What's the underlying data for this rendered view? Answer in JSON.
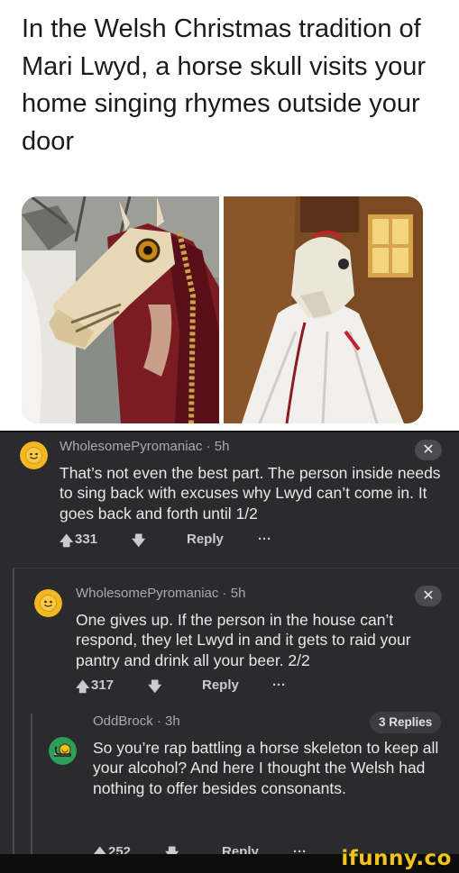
{
  "tweet": {
    "text": "In the Welsh Christmas tradition of Mari Lwyd, a horse skull visits your home singing rhymes outside your door"
  },
  "comments": [
    {
      "username": "WholesomePyromaniac · 5h",
      "body": "That’s not even the best part. The person inside needs to sing back with excuses why Lwyd can’t come in. It goes back and forth until 1/2",
      "upvotes": "331",
      "reply_label": "Reply",
      "more_label": "···",
      "close_label": "✕"
    },
    {
      "username": "WholesomePyromaniac · 5h",
      "body": "One gives up. If the person in the house can’t respond, they let Lwyd in and it gets to raid your pantry and drink all your beer. 2/2",
      "upvotes": "317",
      "reply_label": "Reply",
      "more_label": "···",
      "close_label": "✕"
    },
    {
      "username": "OddBrock · 3h",
      "body": "So you’re rap battling a horse skeleton to keep all your alcohol? And here I thought the Welsh had nothing to offer besides consonants.",
      "upvotes": "252",
      "reply_label": "Reply",
      "more_label": "···",
      "replies_label": "3 Replies"
    }
  ],
  "watermark": "ifunny.co",
  "colors": {
    "dark_bg": "#2b2b2d",
    "avatar_yellow": "#f2b823",
    "avatar_green": "#2e9f5b",
    "watermark": "#f2c318"
  }
}
